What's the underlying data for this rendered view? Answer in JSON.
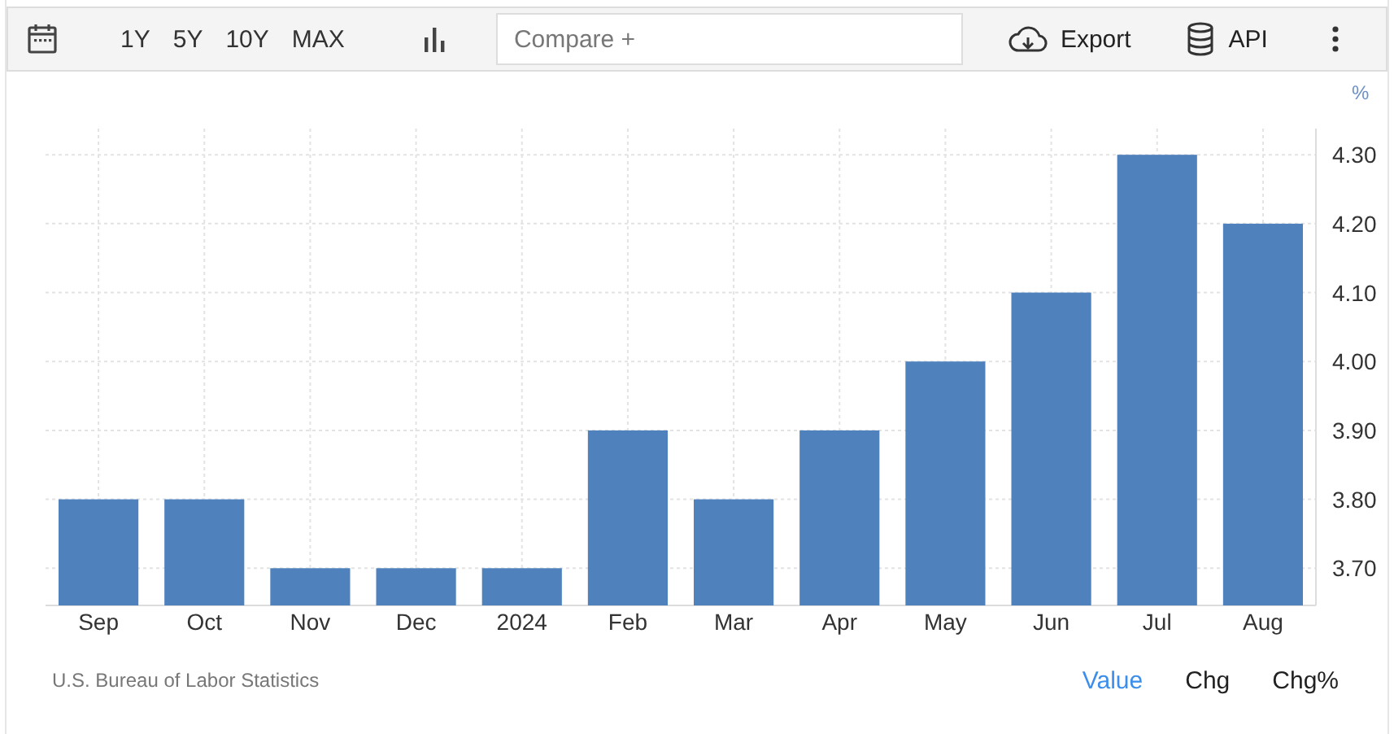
{
  "toolbar": {
    "ranges": [
      "1Y",
      "5Y",
      "10Y",
      "MAX"
    ],
    "compare": {
      "placeholder": "Compare +"
    },
    "export": "Export",
    "api": "API"
  },
  "chart": {
    "chart_data": {
      "type": "bar",
      "ylabel": "%",
      "categories": [
        "Sep",
        "Oct",
        "Nov",
        "Dec",
        "2024",
        "Feb",
        "Mar",
        "Apr",
        "May",
        "Jun",
        "Jul",
        "Aug"
      ],
      "grid": true,
      "series": [
        {
          "color": "#4f81bd",
          "values": [
            3.8,
            3.8,
            3.7,
            3.7,
            3.7,
            3.9,
            3.8,
            3.9,
            4.0,
            4.1,
            4.3,
            4.2
          ]
        }
      ],
      "ylim": [
        3.646,
        4.338
      ],
      "yticks": [
        {
          "value": 3.7,
          "label": "3.70"
        },
        {
          "value": 3.8,
          "label": "3.80"
        },
        {
          "value": 3.9,
          "label": "3.90"
        },
        {
          "value": 4.0,
          "label": "4.00"
        },
        {
          "value": 4.1,
          "label": "4.10"
        },
        {
          "value": 4.2,
          "label": "4.20"
        },
        {
          "value": 4.3,
          "label": "4.30"
        }
      ]
    }
  },
  "footer": {
    "source": "U.S. Bureau of Labor Statistics",
    "modes": [
      {
        "label": "Value",
        "selected": true
      },
      {
        "label": "Chg",
        "selected": false
      },
      {
        "label": "Chg%",
        "selected": false
      }
    ]
  }
}
